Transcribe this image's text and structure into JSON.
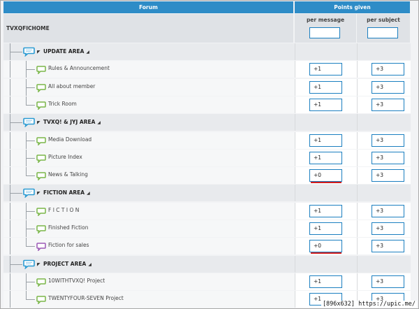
{
  "header": {
    "forum": "Forum",
    "points_given": "Points given"
  },
  "subheader": {
    "site_name": "TVXQFICHOME",
    "per_message": "per message",
    "per_subject": "per subject",
    "per_message_value": "",
    "per_subject_value": ""
  },
  "colors": {
    "header_bg": "#2e8cc7",
    "input_border": "#1b7fc0",
    "forum_icon": "#7ab648",
    "category_icon": "#2b9bd3",
    "sales_icon": "#9b59b6",
    "highlight": "#d11d1d"
  },
  "rows": [
    {
      "type": "category",
      "label": "UPDATE AREA"
    },
    {
      "type": "forum",
      "label": "Rules & Announcement",
      "per_message": "+1",
      "per_subject": "+3"
    },
    {
      "type": "forum",
      "label": "All about member",
      "per_message": "+1",
      "per_subject": "+3"
    },
    {
      "type": "forum",
      "label": "Trick Room",
      "per_message": "+1",
      "per_subject": "+3"
    },
    {
      "type": "category",
      "label": "TVXQ! & JYJ AREA"
    },
    {
      "type": "forum",
      "label": "Media Download",
      "per_message": "+1",
      "per_subject": "+3"
    },
    {
      "type": "forum",
      "label": "Picture Index",
      "per_message": "+1",
      "per_subject": "+3"
    },
    {
      "type": "forum",
      "label": "News & Talking",
      "per_message": "+0",
      "per_subject": "+3",
      "highlight": true
    },
    {
      "type": "category",
      "label": "FICTION AREA"
    },
    {
      "type": "forum",
      "label": "F I C T I O N",
      "per_message": "+1",
      "per_subject": "+3"
    },
    {
      "type": "forum",
      "label": "Finished Fiction",
      "per_message": "+1",
      "per_subject": "+3"
    },
    {
      "type": "forum",
      "label": "Fiction for sales",
      "per_message": "+0",
      "per_subject": "+3",
      "highlight": true,
      "icon_variant": "purple"
    },
    {
      "type": "category",
      "label": "PROJECT AREA"
    },
    {
      "type": "forum",
      "label": "10WITHTVXQ! Project",
      "per_message": "+1",
      "per_subject": "+3"
    },
    {
      "type": "forum",
      "label": "TWENTYFOUR-SEVEN Project",
      "per_message": "+1",
      "per_subject": "+3"
    }
  ],
  "watermark": "[896x632] https://upic.me/"
}
